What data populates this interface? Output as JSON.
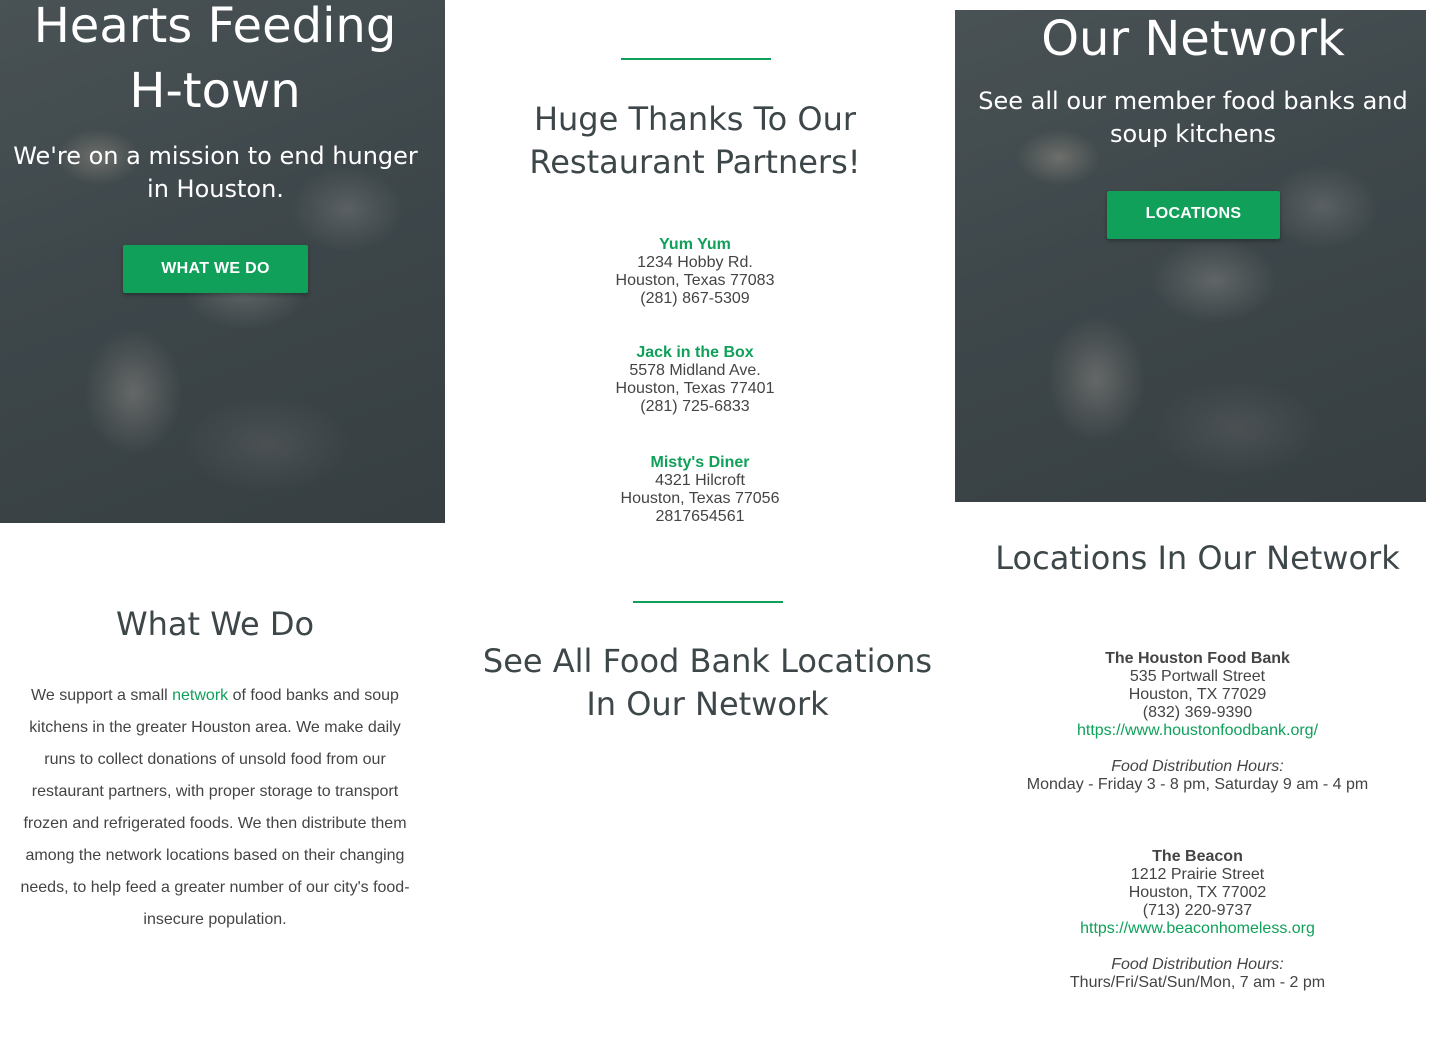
{
  "hero_left": {
    "title": "Hearts Feeding H-town",
    "subtitle": "We're on a mission to end hunger in Houston.",
    "button_label": "WHAT WE DO"
  },
  "hero_right": {
    "title": "Our Network",
    "subtitle": "See all our member food banks and soup kitchens",
    "button_label": "LOCATIONS"
  },
  "partners": {
    "title": "Huge Thanks To Our Restaurant Partners!",
    "items": [
      {
        "name": "Yum Yum",
        "street": "1234 Hobby Rd.",
        "city": "Houston, Texas 77083",
        "phone": "(281) 867-5309"
      },
      {
        "name": "Jack in the Box",
        "street": "5578 Midland Ave.",
        "city": "Houston, Texas 77401",
        "phone": "(281) 725-6833"
      },
      {
        "name": "Misty's Diner",
        "street": "4321 Hilcroft",
        "city": "Houston, Texas 77056",
        "phone": "2817654561"
      }
    ]
  },
  "what_we_do": {
    "title": "What We Do",
    "text_before_link": "We support a small ",
    "link_text": "network",
    "text_after_link": " of food banks and soup kitchens in the greater Houston area. We make daily runs to collect donations of unsold food from our restaurant partners, with proper storage to transport frozen and refrigerated foods. We then distribute them among the network locations based on their changing needs, to help feed a greater number of our city's food-insecure population."
  },
  "see_all": {
    "title": "See All Food Bank Locations In Our Network"
  },
  "locations": {
    "title": "Locations In Our Network",
    "items": [
      {
        "name": "The Houston Food Bank",
        "street": "535 Portwall Street",
        "city": "Houston, TX 77029",
        "phone": "(832) 369-9390",
        "url": "https://www.houstonfoodbank.org/",
        "hours_label": "Food Distribution Hours:",
        "hours": "Monday - Friday 3 - 8 pm, Saturday 9 am - 4 pm"
      },
      {
        "name": "The Beacon",
        "street": "1212 Prairie Street",
        "city": "Houston, TX 77002",
        "phone": "(713) 220-9737",
        "url": "https://www.beaconhomeless.org",
        "hours_label": "Food Distribution Hours:",
        "hours": "Thurs/Fri/Sat/Sun/Mon, 7 am - 2 pm"
      }
    ]
  },
  "colors": {
    "accent": "#10a05a",
    "heading": "#3d4649",
    "body": "#444444"
  }
}
